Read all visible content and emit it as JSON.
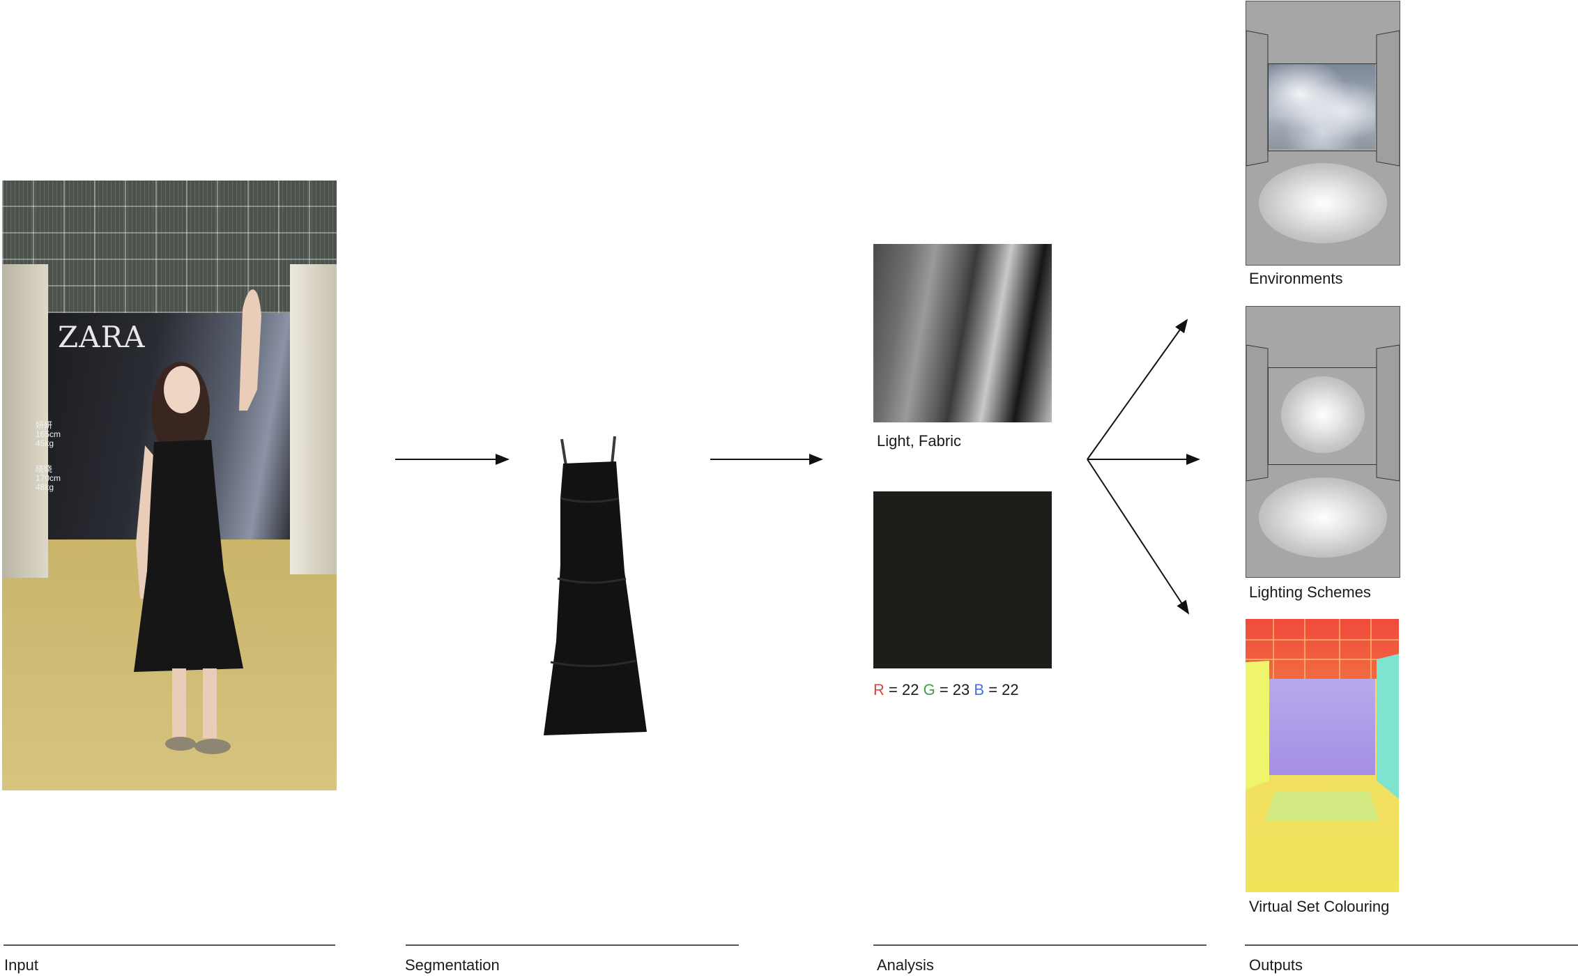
{
  "stages": {
    "input": "Input",
    "segmentation": "Segmentation",
    "analysis": "Analysis",
    "outputs": "Outputs"
  },
  "input_photo": {
    "brand": "ZARA",
    "caption_1_name": "妍妍",
    "caption_1_line_a": "165cm",
    "caption_1_line_b": "45kg",
    "caption_2_name": "晓晓",
    "caption_2_line_a": "170cm",
    "caption_2_line_b": "48kg"
  },
  "analysis": {
    "light_fabric_label": "Light, Fabric",
    "rgb": {
      "r_letter": "R",
      "r_value": "= 22",
      "g_letter": "G",
      "g_value": "= 23",
      "b_letter": "B",
      "b_value": "= 22"
    }
  },
  "outputs": {
    "environments": "Environments",
    "lighting_schemes": "Lighting Schemes",
    "virtual_set_colouring": "Virtual Set Colouring"
  },
  "colors": {
    "r": "#d64545",
    "g": "#3fa046",
    "b": "#4a6fd8",
    "fabric_swatch": "#1d1d1a"
  }
}
